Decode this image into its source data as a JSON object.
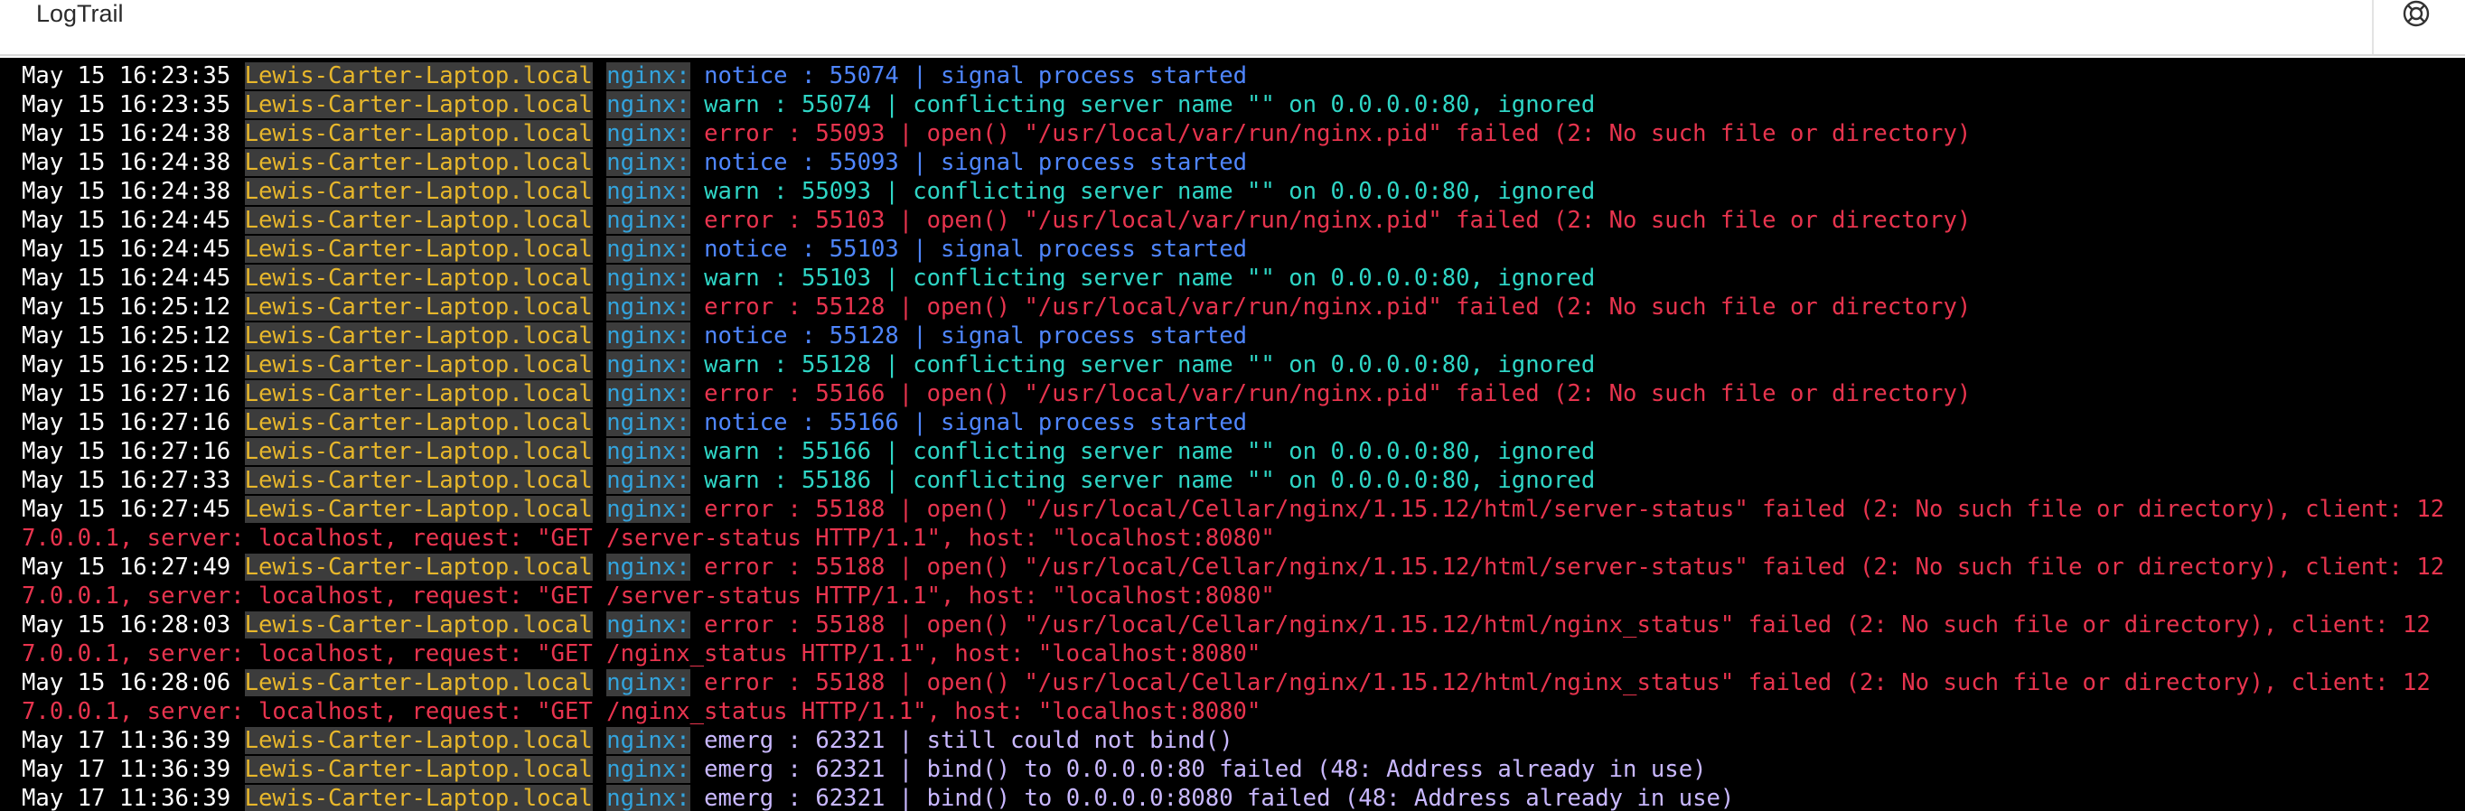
{
  "app": {
    "title": "LogTrail",
    "help_icon": "lifebuoy-icon"
  },
  "colors": {
    "console_bg": "#000000",
    "timestamp": "#ffffff",
    "hostname": "#e8b72b",
    "program": "#33a3dc",
    "notice": "#4f86ff",
    "warn": "#2fd6c6",
    "error": "#e8344e",
    "emerg": "#c9b8ff"
  },
  "log": [
    {
      "ts": "May 15 16:23:35",
      "host": "Lewis-Carter-Laptop.local",
      "prog": "nginx:",
      "level": "notice",
      "msg": "notice : 55074 | signal process started"
    },
    {
      "ts": "May 15 16:23:35",
      "host": "Lewis-Carter-Laptop.local",
      "prog": "nginx:",
      "level": "warn",
      "msg": "warn : 55074 | conflicting server name \"\" on 0.0.0.0:80, ignored"
    },
    {
      "ts": "May 15 16:24:38",
      "host": "Lewis-Carter-Laptop.local",
      "prog": "nginx:",
      "level": "error",
      "msg": "error : 55093 | open() \"/usr/local/var/run/nginx.pid\" failed (2: No such file or directory)"
    },
    {
      "ts": "May 15 16:24:38",
      "host": "Lewis-Carter-Laptop.local",
      "prog": "nginx:",
      "level": "notice",
      "msg": "notice : 55093 | signal process started"
    },
    {
      "ts": "May 15 16:24:38",
      "host": "Lewis-Carter-Laptop.local",
      "prog": "nginx:",
      "level": "warn",
      "msg": "warn : 55093 | conflicting server name \"\" on 0.0.0.0:80, ignored"
    },
    {
      "ts": "May 15 16:24:45",
      "host": "Lewis-Carter-Laptop.local",
      "prog": "nginx:",
      "level": "error",
      "msg": "error : 55103 | open() \"/usr/local/var/run/nginx.pid\" failed (2: No such file or directory)"
    },
    {
      "ts": "May 15 16:24:45",
      "host": "Lewis-Carter-Laptop.local",
      "prog": "nginx:",
      "level": "notice",
      "msg": "notice : 55103 | signal process started"
    },
    {
      "ts": "May 15 16:24:45",
      "host": "Lewis-Carter-Laptop.local",
      "prog": "nginx:",
      "level": "warn",
      "msg": "warn : 55103 | conflicting server name \"\" on 0.0.0.0:80, ignored"
    },
    {
      "ts": "May 15 16:25:12",
      "host": "Lewis-Carter-Laptop.local",
      "prog": "nginx:",
      "level": "error",
      "msg": "error : 55128 | open() \"/usr/local/var/run/nginx.pid\" failed (2: No such file or directory)"
    },
    {
      "ts": "May 15 16:25:12",
      "host": "Lewis-Carter-Laptop.local",
      "prog": "nginx:",
      "level": "notice",
      "msg": "notice : 55128 | signal process started"
    },
    {
      "ts": "May 15 16:25:12",
      "host": "Lewis-Carter-Laptop.local",
      "prog": "nginx:",
      "level": "warn",
      "msg": "warn : 55128 | conflicting server name \"\" on 0.0.0.0:80, ignored"
    },
    {
      "ts": "May 15 16:27:16",
      "host": "Lewis-Carter-Laptop.local",
      "prog": "nginx:",
      "level": "error",
      "msg": "error : 55166 | open() \"/usr/local/var/run/nginx.pid\" failed (2: No such file or directory)"
    },
    {
      "ts": "May 15 16:27:16",
      "host": "Lewis-Carter-Laptop.local",
      "prog": "nginx:",
      "level": "notice",
      "msg": "notice : 55166 | signal process started"
    },
    {
      "ts": "May 15 16:27:16",
      "host": "Lewis-Carter-Laptop.local",
      "prog": "nginx:",
      "level": "warn",
      "msg": "warn : 55166 | conflicting server name \"\" on 0.0.0.0:80, ignored"
    },
    {
      "ts": "May 15 16:27:33",
      "host": "Lewis-Carter-Laptop.local",
      "prog": "nginx:",
      "level": "warn",
      "msg": "warn : 55186 | conflicting server name \"\" on 0.0.0.0:80, ignored"
    },
    {
      "ts": "May 15 16:27:45",
      "host": "Lewis-Carter-Laptop.local",
      "prog": "nginx:",
      "level": "error",
      "msg": "error : 55188 | open() \"/usr/local/Cellar/nginx/1.15.12/html/server-status\" failed (2: No such file or directory), client: 127.0.0.1, server: localhost, request: \"GET /server-status HTTP/1.1\", host: \"localhost:8080\""
    },
    {
      "ts": "May 15 16:27:49",
      "host": "Lewis-Carter-Laptop.local",
      "prog": "nginx:",
      "level": "error",
      "msg": "error : 55188 | open() \"/usr/local/Cellar/nginx/1.15.12/html/server-status\" failed (2: No such file or directory), client: 127.0.0.1, server: localhost, request: \"GET /server-status HTTP/1.1\", host: \"localhost:8080\""
    },
    {
      "ts": "May 15 16:28:03",
      "host": "Lewis-Carter-Laptop.local",
      "prog": "nginx:",
      "level": "error",
      "msg": "error : 55188 | open() \"/usr/local/Cellar/nginx/1.15.12/html/nginx_status\" failed (2: No such file or directory), client: 127.0.0.1, server: localhost, request: \"GET /nginx_status HTTP/1.1\", host: \"localhost:8080\""
    },
    {
      "ts": "May 15 16:28:06",
      "host": "Lewis-Carter-Laptop.local",
      "prog": "nginx:",
      "level": "error",
      "msg": "error : 55188 | open() \"/usr/local/Cellar/nginx/1.15.12/html/nginx_status\" failed (2: No such file or directory), client: 127.0.0.1, server: localhost, request: \"GET /nginx_status HTTP/1.1\", host: \"localhost:8080\""
    },
    {
      "ts": "May 17 11:36:39",
      "host": "Lewis-Carter-Laptop.local",
      "prog": "nginx:",
      "level": "emerg",
      "msg": "emerg : 62321 | still could not bind()"
    },
    {
      "ts": "May 17 11:36:39",
      "host": "Lewis-Carter-Laptop.local",
      "prog": "nginx:",
      "level": "emerg",
      "msg": "emerg : 62321 | bind() to 0.0.0.0:80 failed (48: Address already in use)"
    },
    {
      "ts": "May 17 11:36:39",
      "host": "Lewis-Carter-Laptop.local",
      "prog": "nginx:",
      "level": "emerg",
      "msg": "emerg : 62321 | bind() to 0.0.0.0:8080 failed (48: Address already in use)"
    }
  ]
}
